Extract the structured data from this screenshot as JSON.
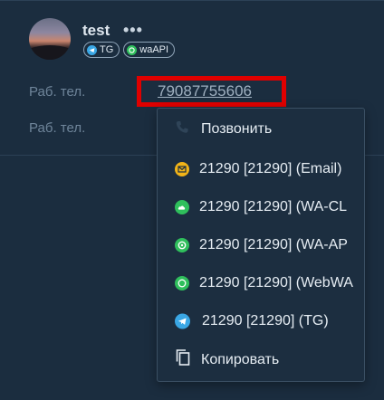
{
  "contact": {
    "name": "test",
    "more": "•••",
    "badges": [
      {
        "label": "TG",
        "color": "#3aa7e5",
        "icon": "telegram-icon"
      },
      {
        "label": "waAPI",
        "color": "#2fbf5c",
        "icon": "whatsapp-icon"
      }
    ]
  },
  "fields": [
    {
      "label": "Раб. тел.",
      "value": "79087755606"
    },
    {
      "label": "Раб. тел."
    }
  ],
  "menu": {
    "items": [
      {
        "label": "Позвонить",
        "icon": "phone-icon"
      },
      {
        "label": "21290 [21290] (Email)",
        "icon": "email-icon",
        "color": "#f2b418"
      },
      {
        "label": "21290 [21290] (WA-CL",
        "icon": "whatsapp-cloud-icon",
        "color": "#2fbf5c"
      },
      {
        "label": "21290 [21290] (WA-AP",
        "icon": "whatsapp-api-icon",
        "color": "#2fbf5c"
      },
      {
        "label": "21290 [21290] (WebWA",
        "icon": "whatsapp-web-icon",
        "color": "#2fbf5c"
      },
      {
        "label": "21290 [21290] (TG)",
        "icon": "telegram-icon",
        "color": "#3aa7e5"
      },
      {
        "label": "Копировать",
        "icon": "copy-icon"
      }
    ]
  },
  "highlight_color": "#e00000"
}
